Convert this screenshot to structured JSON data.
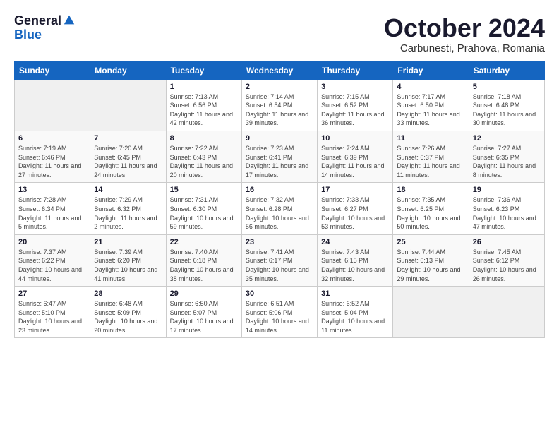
{
  "header": {
    "logo": {
      "general": "General",
      "blue": "Blue"
    },
    "title": "October 2024",
    "location": "Carbunesti, Prahova, Romania"
  },
  "days_of_week": [
    "Sunday",
    "Monday",
    "Tuesday",
    "Wednesday",
    "Thursday",
    "Friday",
    "Saturday"
  ],
  "weeks": [
    [
      {
        "day": "",
        "info": ""
      },
      {
        "day": "",
        "info": ""
      },
      {
        "day": "1",
        "sunrise": "Sunrise: 7:13 AM",
        "sunset": "Sunset: 6:56 PM",
        "daylight": "Daylight: 11 hours and 42 minutes."
      },
      {
        "day": "2",
        "sunrise": "Sunrise: 7:14 AM",
        "sunset": "Sunset: 6:54 PM",
        "daylight": "Daylight: 11 hours and 39 minutes."
      },
      {
        "day": "3",
        "sunrise": "Sunrise: 7:15 AM",
        "sunset": "Sunset: 6:52 PM",
        "daylight": "Daylight: 11 hours and 36 minutes."
      },
      {
        "day": "4",
        "sunrise": "Sunrise: 7:17 AM",
        "sunset": "Sunset: 6:50 PM",
        "daylight": "Daylight: 11 hours and 33 minutes."
      },
      {
        "day": "5",
        "sunrise": "Sunrise: 7:18 AM",
        "sunset": "Sunset: 6:48 PM",
        "daylight": "Daylight: 11 hours and 30 minutes."
      }
    ],
    [
      {
        "day": "6",
        "sunrise": "Sunrise: 7:19 AM",
        "sunset": "Sunset: 6:46 PM",
        "daylight": "Daylight: 11 hours and 27 minutes."
      },
      {
        "day": "7",
        "sunrise": "Sunrise: 7:20 AM",
        "sunset": "Sunset: 6:45 PM",
        "daylight": "Daylight: 11 hours and 24 minutes."
      },
      {
        "day": "8",
        "sunrise": "Sunrise: 7:22 AM",
        "sunset": "Sunset: 6:43 PM",
        "daylight": "Daylight: 11 hours and 20 minutes."
      },
      {
        "day": "9",
        "sunrise": "Sunrise: 7:23 AM",
        "sunset": "Sunset: 6:41 PM",
        "daylight": "Daylight: 11 hours and 17 minutes."
      },
      {
        "day": "10",
        "sunrise": "Sunrise: 7:24 AM",
        "sunset": "Sunset: 6:39 PM",
        "daylight": "Daylight: 11 hours and 14 minutes."
      },
      {
        "day": "11",
        "sunrise": "Sunrise: 7:26 AM",
        "sunset": "Sunset: 6:37 PM",
        "daylight": "Daylight: 11 hours and 11 minutes."
      },
      {
        "day": "12",
        "sunrise": "Sunrise: 7:27 AM",
        "sunset": "Sunset: 6:35 PM",
        "daylight": "Daylight: 11 hours and 8 minutes."
      }
    ],
    [
      {
        "day": "13",
        "sunrise": "Sunrise: 7:28 AM",
        "sunset": "Sunset: 6:34 PM",
        "daylight": "Daylight: 11 hours and 5 minutes."
      },
      {
        "day": "14",
        "sunrise": "Sunrise: 7:29 AM",
        "sunset": "Sunset: 6:32 PM",
        "daylight": "Daylight: 11 hours and 2 minutes."
      },
      {
        "day": "15",
        "sunrise": "Sunrise: 7:31 AM",
        "sunset": "Sunset: 6:30 PM",
        "daylight": "Daylight: 10 hours and 59 minutes."
      },
      {
        "day": "16",
        "sunrise": "Sunrise: 7:32 AM",
        "sunset": "Sunset: 6:28 PM",
        "daylight": "Daylight: 10 hours and 56 minutes."
      },
      {
        "day": "17",
        "sunrise": "Sunrise: 7:33 AM",
        "sunset": "Sunset: 6:27 PM",
        "daylight": "Daylight: 10 hours and 53 minutes."
      },
      {
        "day": "18",
        "sunrise": "Sunrise: 7:35 AM",
        "sunset": "Sunset: 6:25 PM",
        "daylight": "Daylight: 10 hours and 50 minutes."
      },
      {
        "day": "19",
        "sunrise": "Sunrise: 7:36 AM",
        "sunset": "Sunset: 6:23 PM",
        "daylight": "Daylight: 10 hours and 47 minutes."
      }
    ],
    [
      {
        "day": "20",
        "sunrise": "Sunrise: 7:37 AM",
        "sunset": "Sunset: 6:22 PM",
        "daylight": "Daylight: 10 hours and 44 minutes."
      },
      {
        "day": "21",
        "sunrise": "Sunrise: 7:39 AM",
        "sunset": "Sunset: 6:20 PM",
        "daylight": "Daylight: 10 hours and 41 minutes."
      },
      {
        "day": "22",
        "sunrise": "Sunrise: 7:40 AM",
        "sunset": "Sunset: 6:18 PM",
        "daylight": "Daylight: 10 hours and 38 minutes."
      },
      {
        "day": "23",
        "sunrise": "Sunrise: 7:41 AM",
        "sunset": "Sunset: 6:17 PM",
        "daylight": "Daylight: 10 hours and 35 minutes."
      },
      {
        "day": "24",
        "sunrise": "Sunrise: 7:43 AM",
        "sunset": "Sunset: 6:15 PM",
        "daylight": "Daylight: 10 hours and 32 minutes."
      },
      {
        "day": "25",
        "sunrise": "Sunrise: 7:44 AM",
        "sunset": "Sunset: 6:13 PM",
        "daylight": "Daylight: 10 hours and 29 minutes."
      },
      {
        "day": "26",
        "sunrise": "Sunrise: 7:45 AM",
        "sunset": "Sunset: 6:12 PM",
        "daylight": "Daylight: 10 hours and 26 minutes."
      }
    ],
    [
      {
        "day": "27",
        "sunrise": "Sunrise: 6:47 AM",
        "sunset": "Sunset: 5:10 PM",
        "daylight": "Daylight: 10 hours and 23 minutes."
      },
      {
        "day": "28",
        "sunrise": "Sunrise: 6:48 AM",
        "sunset": "Sunset: 5:09 PM",
        "daylight": "Daylight: 10 hours and 20 minutes."
      },
      {
        "day": "29",
        "sunrise": "Sunrise: 6:50 AM",
        "sunset": "Sunset: 5:07 PM",
        "daylight": "Daylight: 10 hours and 17 minutes."
      },
      {
        "day": "30",
        "sunrise": "Sunrise: 6:51 AM",
        "sunset": "Sunset: 5:06 PM",
        "daylight": "Daylight: 10 hours and 14 minutes."
      },
      {
        "day": "31",
        "sunrise": "Sunrise: 6:52 AM",
        "sunset": "Sunset: 5:04 PM",
        "daylight": "Daylight: 10 hours and 11 minutes."
      },
      {
        "day": "",
        "info": ""
      },
      {
        "day": "",
        "info": ""
      }
    ]
  ]
}
